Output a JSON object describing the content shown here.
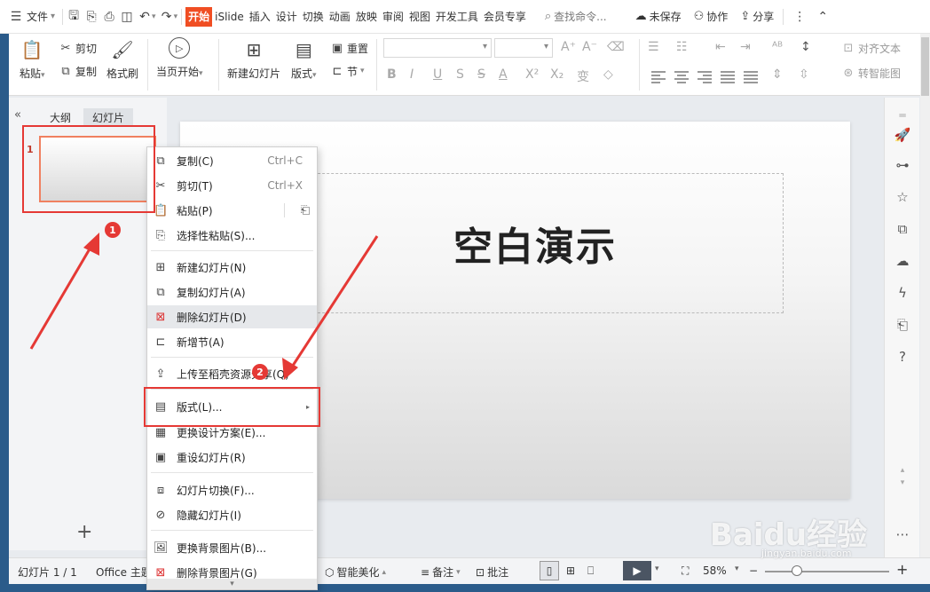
{
  "menubar": {
    "file": "文件",
    "tabs": [
      "开始",
      "iSlide",
      "插入",
      "设计",
      "切换",
      "动画",
      "放映",
      "审阅",
      "视图",
      "开发工具",
      "会员专享"
    ],
    "search": "查找命令...",
    "unsaved": "未保存",
    "collab": "协作",
    "share": "分享"
  },
  "ribbon": {
    "paste": "粘贴",
    "cut": "剪切",
    "copy": "复制",
    "format_painter": "格式刷",
    "from_current": "当页开始",
    "new_slide": "新建幻灯片",
    "layout": "版式",
    "reset": "重置",
    "section": "节",
    "align_text": "对齐文本",
    "to_smartart": "转智能图"
  },
  "left_panel": {
    "tab_outline": "大纲",
    "tab_slides": "幻灯片",
    "slide_number": "1",
    "add": "+"
  },
  "canvas": {
    "title": "空白演示"
  },
  "context_menu": {
    "items": [
      {
        "label": "复制(C)",
        "shortcut": "Ctrl+C",
        "icon": "copy-icon"
      },
      {
        "label": "剪切(T)",
        "shortcut": "Ctrl+X",
        "icon": "scissors-icon"
      },
      {
        "label": "粘贴(P)",
        "shortcut": "",
        "icon": "clipboard-icon"
      },
      {
        "label": "选择性粘贴(S)...",
        "shortcut": "",
        "icon": "paste-special-icon"
      },
      {
        "label": "新建幻灯片(N)",
        "shortcut": "",
        "icon": "new-slide-icon"
      },
      {
        "label": "复制幻灯片(A)",
        "shortcut": "",
        "icon": "duplicate-slide-icon"
      },
      {
        "label": "删除幻灯片(D)",
        "shortcut": "",
        "icon": "delete-slide-icon"
      },
      {
        "label": "新增节(A)",
        "shortcut": "",
        "icon": "section-icon"
      },
      {
        "label": "上传至稻壳资源分享(Q)",
        "shortcut": "",
        "icon": "upload-icon"
      },
      {
        "label": "版式(L)...",
        "shortcut": "",
        "icon": "layout-icon"
      },
      {
        "label": "更换设计方案(E)...",
        "shortcut": "",
        "icon": "design-icon"
      },
      {
        "label": "重设幻灯片(R)",
        "shortcut": "",
        "icon": "reset-icon"
      },
      {
        "label": "幻灯片切换(F)...",
        "shortcut": "",
        "icon": "transition-icon"
      },
      {
        "label": "隐藏幻灯片(I)",
        "shortcut": "",
        "icon": "hide-icon"
      },
      {
        "label": "更换背景图片(B)...",
        "shortcut": "",
        "icon": "background-icon"
      },
      {
        "label": "删除背景图片(G)",
        "shortcut": "",
        "icon": "delete-background-icon"
      }
    ]
  },
  "annotations": {
    "badge1": "1",
    "badge2": "2"
  },
  "statusbar": {
    "slide_info": "幻灯片 1 / 1",
    "theme": "Office 主题",
    "beautify": "智能美化",
    "notes": "备注",
    "comments": "批注",
    "zoom": "58%"
  },
  "watermark": {
    "text": "Baidu经验",
    "sub": "jingyan.baidu.com"
  },
  "colors": {
    "accent": "#f04e23",
    "annotation_red": "#e53935"
  }
}
